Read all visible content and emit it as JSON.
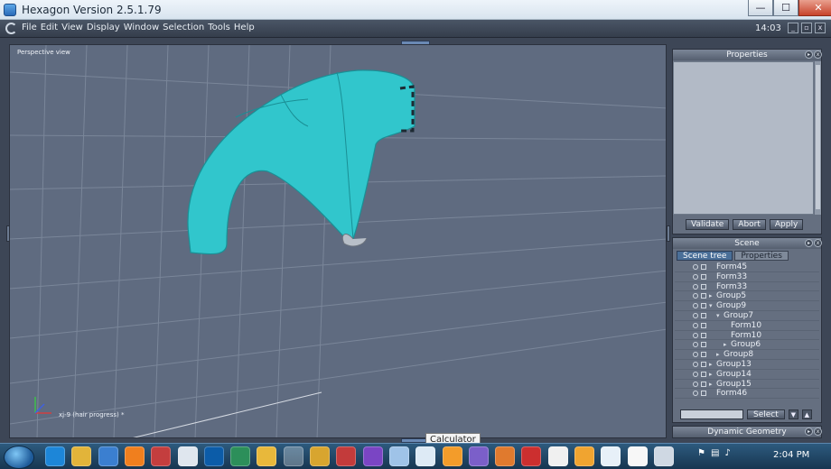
{
  "window": {
    "title": "Hexagon Version 2.5.1.79",
    "controls": {
      "minimize": "—",
      "maximize": "☐",
      "close": "✕"
    }
  },
  "menubar": {
    "items": [
      "File",
      "Edit",
      "View",
      "Display",
      "Window",
      "Selection",
      "Tools",
      "Help"
    ],
    "clock": "14:03",
    "controls": {
      "minimize": "_",
      "restore": "▫",
      "close": "x"
    }
  },
  "viewport": {
    "label": "Perspective view",
    "status": "xj-9 (hair progress) *",
    "model_color": "#31c6cc"
  },
  "properties_panel": {
    "title": "Properties",
    "buttons": [
      "Validate",
      "Abort",
      "Apply"
    ]
  },
  "scene_panel": {
    "title": "Scene",
    "tabs": [
      "Scene tree",
      "Properties"
    ],
    "tree": [
      {
        "label": "Form45",
        "level": 0,
        "arrow": ""
      },
      {
        "label": "Form33",
        "level": 0,
        "arrow": ""
      },
      {
        "label": "Form33",
        "level": 0,
        "arrow": ""
      },
      {
        "label": "Group5",
        "level": 0,
        "arrow": "▸"
      },
      {
        "label": "Group9",
        "level": 0,
        "arrow": "▾"
      },
      {
        "label": "Group7",
        "level": 1,
        "arrow": "▾"
      },
      {
        "label": "Form10",
        "level": 2,
        "arrow": ""
      },
      {
        "label": "Form10",
        "level": 2,
        "arrow": ""
      },
      {
        "label": "Group6",
        "level": 2,
        "arrow": "▸"
      },
      {
        "label": "Group8",
        "level": 1,
        "arrow": "▸"
      },
      {
        "label": "Group13",
        "level": 0,
        "arrow": "▸"
      },
      {
        "label": "Group14",
        "level": 0,
        "arrow": "▸"
      },
      {
        "label": "Group15",
        "level": 0,
        "arrow": "▸"
      },
      {
        "label": "Form46",
        "level": 0,
        "arrow": ""
      }
    ],
    "select_button": "Select"
  },
  "dynamic_geometry_panel": {
    "title": "Dynamic Geometry"
  },
  "tooltip": "Calculator",
  "taskbar": {
    "clock": "2:04 PM",
    "apps": [
      "ie-icon",
      "explorer-icon",
      "media-player-icon",
      "vlc-icon",
      "app-icon",
      "app-icon",
      "photoshop-icon",
      "app-icon",
      "app-icon",
      "hexagon-icon",
      "app-icon",
      "app-icon",
      "app-icon",
      "app-icon",
      "calculator-icon",
      "app-icon",
      "app-icon",
      "app-icon",
      "app-icon",
      "app-icon",
      "app-icon",
      "app-icon",
      "app-icon",
      "app-icon"
    ]
  }
}
